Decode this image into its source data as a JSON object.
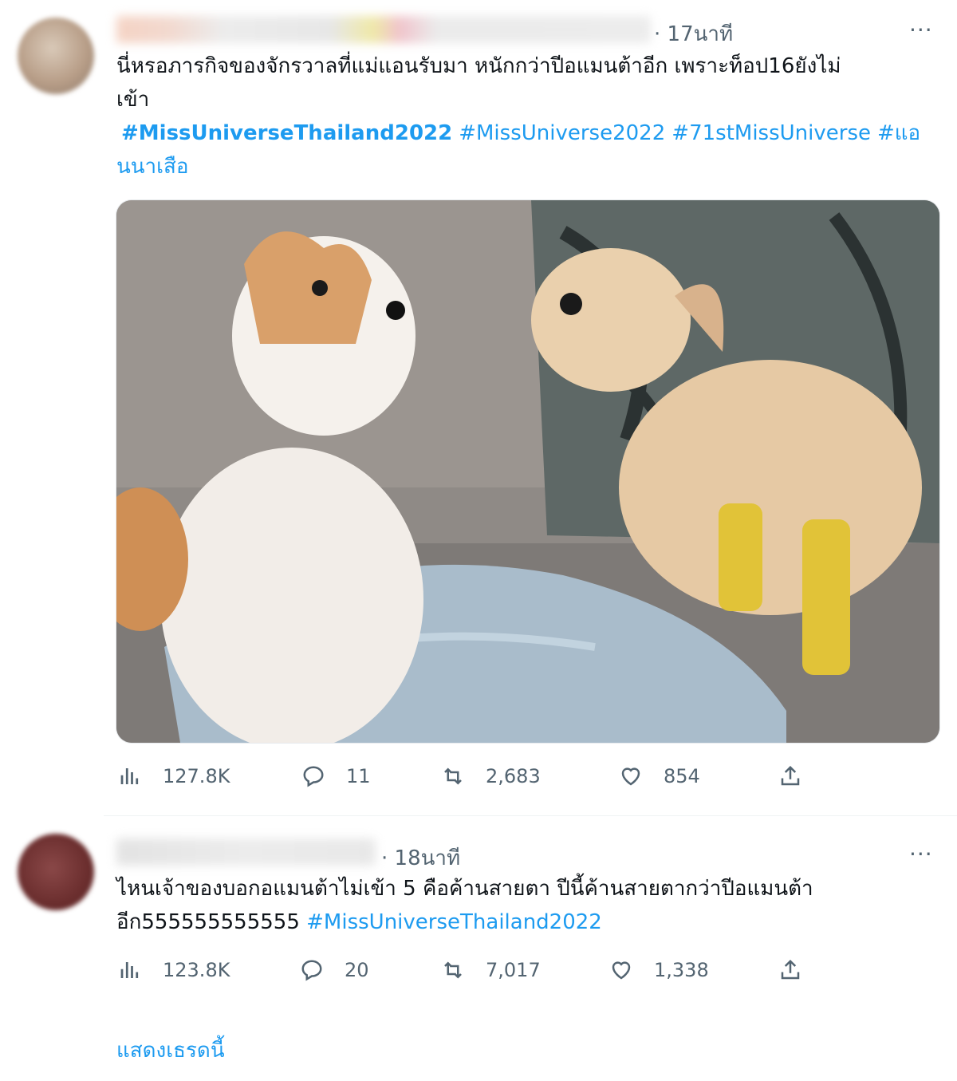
{
  "tweets": [
    {
      "time": "· 17นาที",
      "more": "···",
      "text_line1": "นี่หรอภารกิจของจักรวาลที่แม่แอนรับมา หนักกว่าปีอแมนต้าอีก เพราะท็อป16ยังไม่",
      "text_line2": "เข้า",
      "hashtags": [
        "#MissUniverseThailand2022",
        "#MissUniverse2022",
        "#71stMissUniverse",
        "#แอ"
      ],
      "hashtag_wrap": "นนาเสือ",
      "stats": {
        "views": "127.8K",
        "replies": "11",
        "retweets": "2,683",
        "likes": "854"
      }
    },
    {
      "time": "· 18นาที",
      "more": "···",
      "text_line1": "ไหนเจ้าของบอกอแมนต้าไม่เข้า 5 คือค้านสายตา ปีนี้ค้านสายตากว่าปีอแมนต้า",
      "text_line2_plain": "อีก555555555555",
      "hashtag": "#MissUniverseThailand2022",
      "stats": {
        "views": "123.8K",
        "replies": "20",
        "retweets": "7,017",
        "likes": "1,338"
      }
    }
  ],
  "show_thread": "แสดงเธรดนี้",
  "colors": {
    "link": "#1d9bf0",
    "muted": "#536471",
    "text": "#0f1419"
  },
  "icons": [
    "views-icon",
    "reply-icon",
    "retweet-icon",
    "like-icon",
    "share-icon"
  ]
}
